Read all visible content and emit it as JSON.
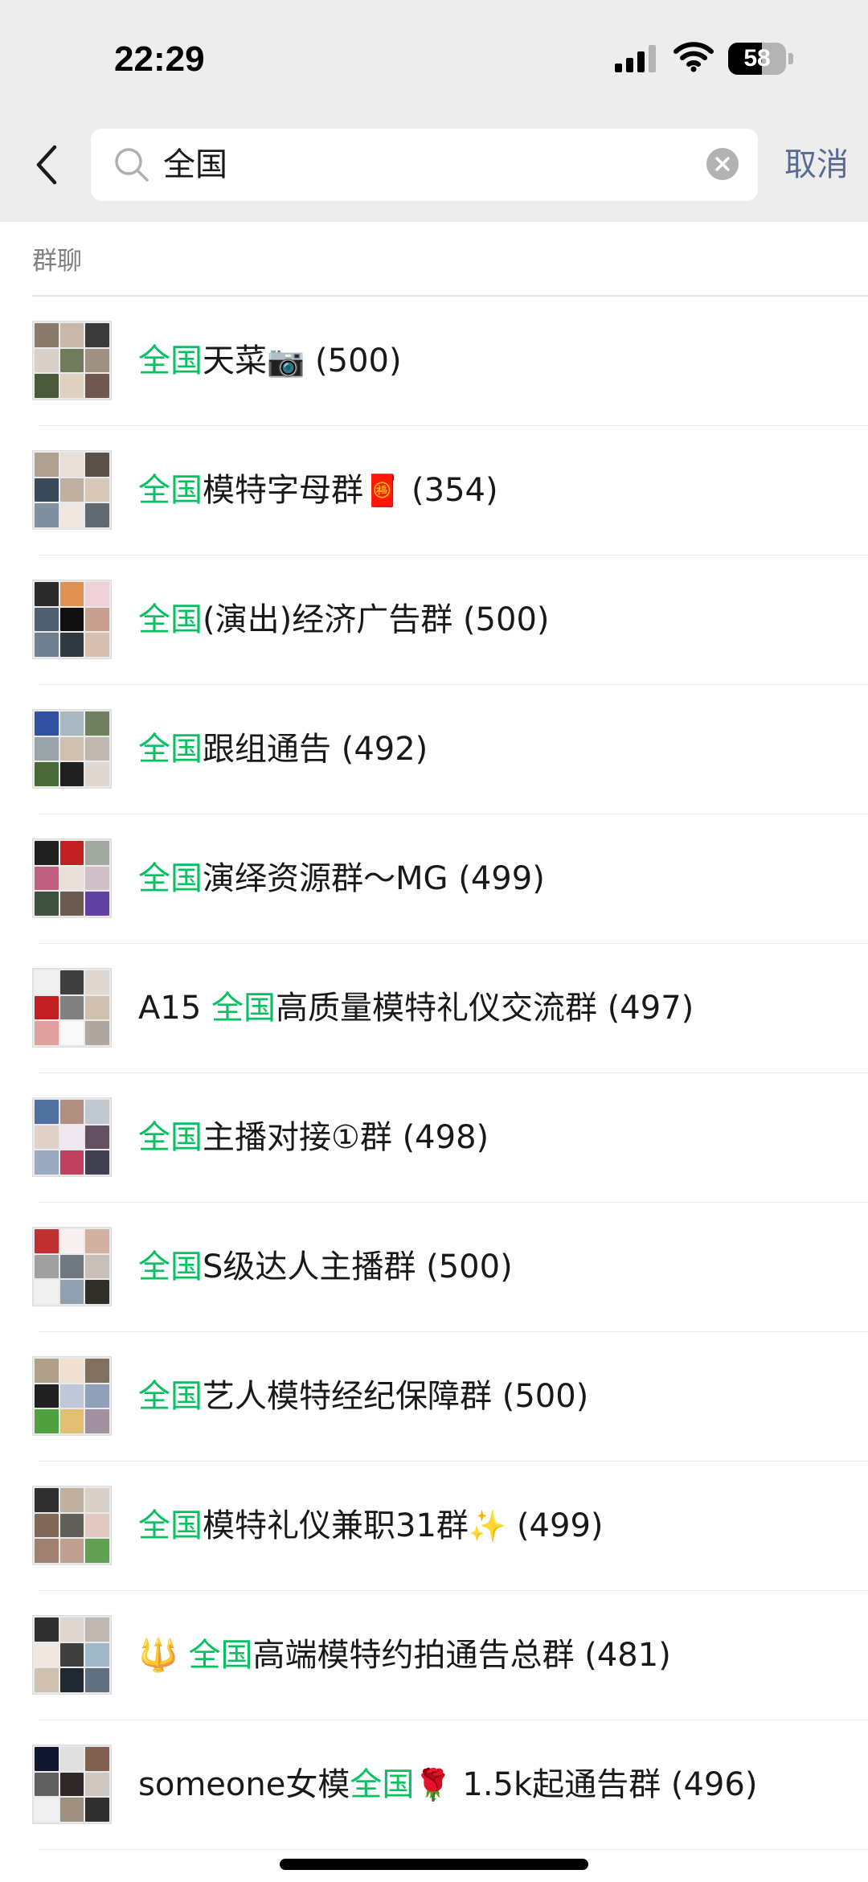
{
  "status_bar": {
    "time": "22:29",
    "battery": "58"
  },
  "search": {
    "query": "全国",
    "cancel_label": "取消"
  },
  "section_title": "群聊",
  "colors": {
    "highlight": "#07c160",
    "link": "#576b95",
    "header_bg": "#ededed"
  },
  "results": [
    {
      "prefix": "",
      "highlight": "全国",
      "rest": "天菜",
      "emoji": "📷",
      "count": "(500)"
    },
    {
      "prefix": "",
      "highlight": "全国",
      "rest": "模特字母群",
      "emoji": "🧧",
      "count": "(354)"
    },
    {
      "prefix": "",
      "highlight": "全国",
      "rest": "(演出)经济广告群",
      "emoji": "",
      "count": "(500)"
    },
    {
      "prefix": "",
      "highlight": "全国",
      "rest": "跟组通告",
      "emoji": "",
      "count": "(492)"
    },
    {
      "prefix": "",
      "highlight": "全国",
      "rest": "演绎资源群～MG",
      "emoji": "",
      "count": "(499)"
    },
    {
      "prefix": "A15 ",
      "highlight": "全国",
      "rest": "高质量模特礼仪交流群",
      "emoji": "",
      "count": "(497)"
    },
    {
      "prefix": "",
      "highlight": "全国",
      "rest": "主播对接①群",
      "emoji": "",
      "count": "(498)"
    },
    {
      "prefix": "",
      "highlight": "全国",
      "rest": "S级达人主播群",
      "emoji": "",
      "count": "(500)"
    },
    {
      "prefix": "",
      "highlight": "全国",
      "rest": "艺人模特经纪保障群",
      "emoji": "",
      "count": "(500)"
    },
    {
      "prefix": "",
      "highlight": "全国",
      "rest": "模特礼仪兼职31群",
      "emoji": "✨",
      "count": "(499)"
    },
    {
      "prefix": "🔱 ",
      "highlight": "全国",
      "rest": "高端模特约拍通告总群",
      "emoji": "",
      "count": "(481)"
    },
    {
      "prefix": "someone女模",
      "highlight": "全国",
      "rest": "",
      "emoji": "🌹",
      "count": "1.5k起通告群 (496)"
    }
  ]
}
